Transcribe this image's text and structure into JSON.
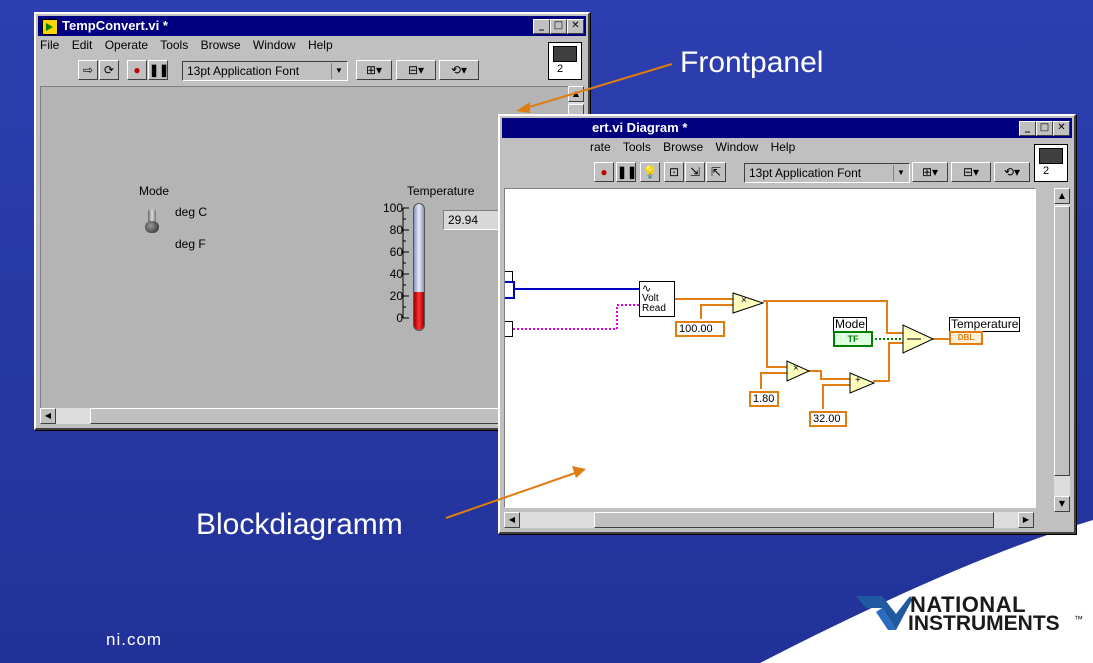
{
  "slide": {
    "frontpanel_label": "Frontpanel",
    "blockdiagram_label": "Blockdiagramm",
    "footer_url": "ni.com",
    "logo_line1": "NATIONAL",
    "logo_line2": "INSTRUMENTS",
    "logo_trademark": "™"
  },
  "front_window": {
    "title": "TempConvert.vi *",
    "menu": [
      "File",
      "Edit",
      "Operate",
      "Tools",
      "Browse",
      "Window",
      "Help"
    ],
    "font_select": "13pt Application Font",
    "connector_label": "2",
    "mode_label": "Mode",
    "switch_on_label": "deg C",
    "switch_off_label": "deg F",
    "temperature_label": "Temperature",
    "temperature_value": "29.94",
    "thermometer_scale": [
      "100",
      "80",
      "60",
      "40",
      "20",
      "0"
    ],
    "thermometer_fill_fraction": 0.3
  },
  "diagram_window": {
    "title": "ert.vi Diagram *",
    "menu": [
      "rate",
      "Tools",
      "Browse",
      "Window",
      "Help"
    ],
    "font_select": "13pt Application Font",
    "connector_label": "2",
    "volt_read_label_1": "Volt",
    "volt_read_label_2": "Read",
    "const_100": "100.00",
    "const_180": "1.80",
    "const_32": "32.00",
    "mode_label": "Mode",
    "mode_terminal": "TF",
    "temperature_label": "Temperature",
    "temperature_terminal": "DBL",
    "multiply_symbol": "×",
    "add_symbol": "+"
  },
  "colors": {
    "slide_bg": "#2a3ba8",
    "wire_orange": "#e07c10",
    "wire_green": "#008000",
    "wire_blue": "#0000c0",
    "wire_pink": "#e000e0",
    "thermo_red": "#e01010",
    "titlebar": "#000080"
  }
}
